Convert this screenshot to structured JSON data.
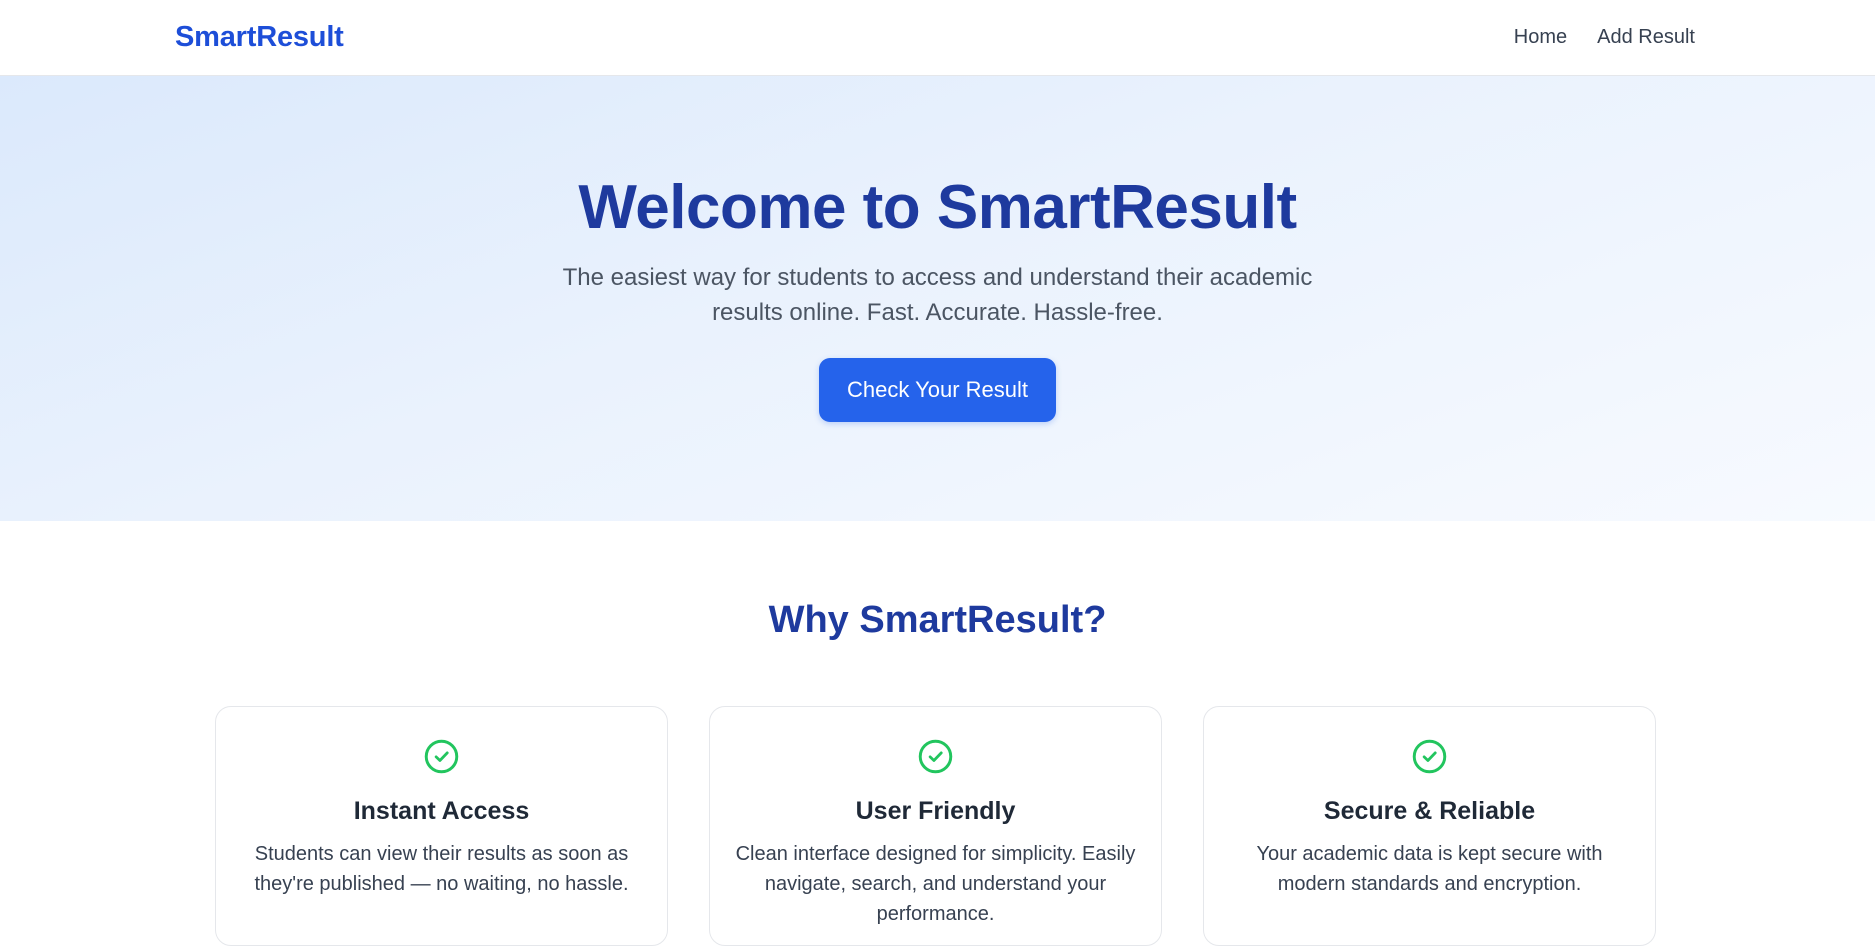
{
  "header": {
    "brand": "SmartResult",
    "nav": [
      {
        "label": "Home"
      },
      {
        "label": "Add Result"
      }
    ]
  },
  "hero": {
    "title": "Welcome to SmartResult",
    "subtitle": "The easiest way for students to access and understand their academic results online. Fast. Accurate. Hassle-free.",
    "cta_label": "Check Your Result"
  },
  "features": {
    "title": "Why SmartResult?",
    "cards": [
      {
        "icon": "check-circle-icon",
        "title": "Instant Access",
        "text": "Students can view their results as soon as they're published — no waiting, no hassle."
      },
      {
        "icon": "check-circle-icon",
        "title": "User Friendly",
        "text": "Clean interface designed for simplicity. Easily navigate, search, and understand your performance."
      },
      {
        "icon": "check-circle-icon",
        "title": "Secure & Reliable",
        "text": "Your academic data is kept secure with modern standards and encryption."
      }
    ]
  },
  "colors": {
    "brand": "#1d4ed8",
    "heading": "#1e3a9e",
    "button": "#2563eb",
    "check": "#22c55e"
  }
}
